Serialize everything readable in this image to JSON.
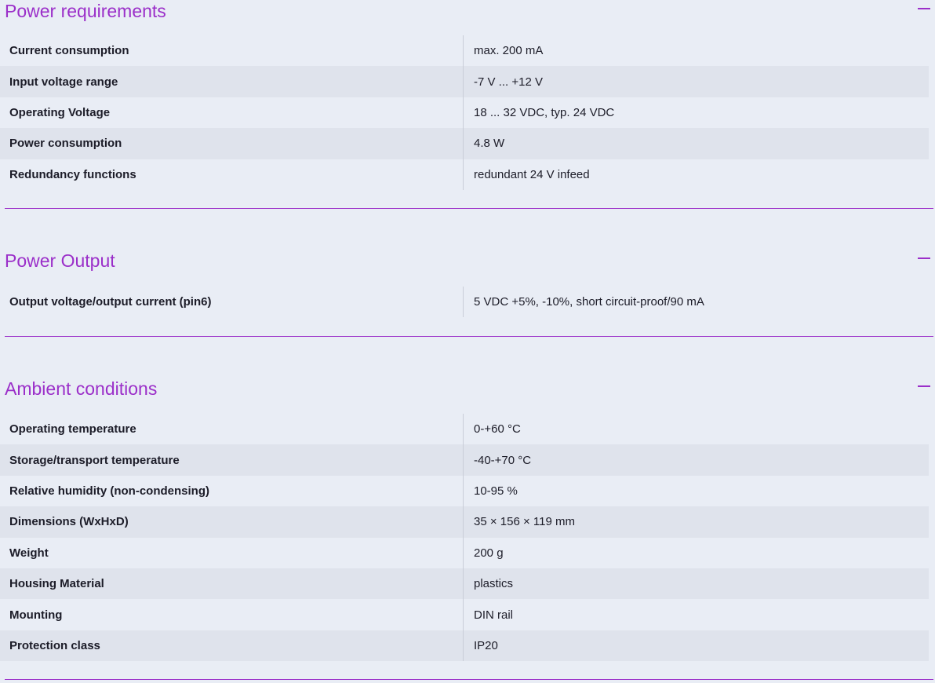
{
  "sections": [
    {
      "title": "Power requirements",
      "rows": [
        {
          "label": "Current consumption",
          "value": "max. 200 mA"
        },
        {
          "label": "Input voltage range",
          "value": "-7 V ... +12 V"
        },
        {
          "label": "Operating Voltage",
          "value": "18 ... 32 VDC, typ. 24 VDC"
        },
        {
          "label": "Power consumption",
          "value": "4.8 W"
        },
        {
          "label": "Redundancy functions",
          "value": "redundant 24 V infeed"
        }
      ]
    },
    {
      "title": "Power Output",
      "rows": [
        {
          "label": "Output voltage/output current (pin6)",
          "value": "5 VDC +5%, -10%, short circuit-proof/90 mA"
        }
      ]
    },
    {
      "title": "Ambient conditions",
      "rows": [
        {
          "label": "Operating temperature",
          "value": "0-+60 °C"
        },
        {
          "label": "Storage/transport temperature",
          "value": "-40-+70 °C"
        },
        {
          "label": "Relative humidity (non-condensing)",
          "value": "10-95 %"
        },
        {
          "label": "Dimensions (WxHxD)",
          "value": "35 × 156 × 119 mm"
        },
        {
          "label": "Weight",
          "value": "200 g"
        },
        {
          "label": "Housing Material",
          "value": "plastics"
        },
        {
          "label": "Mounting",
          "value": "DIN rail"
        },
        {
          "label": "Protection class",
          "value": "IP20"
        }
      ]
    }
  ],
  "colors": {
    "accent": "#9b2fc9",
    "background": "#e9edf5",
    "row_alt": "#dfe3ec"
  },
  "icons": {
    "collapse": "minus-icon"
  }
}
